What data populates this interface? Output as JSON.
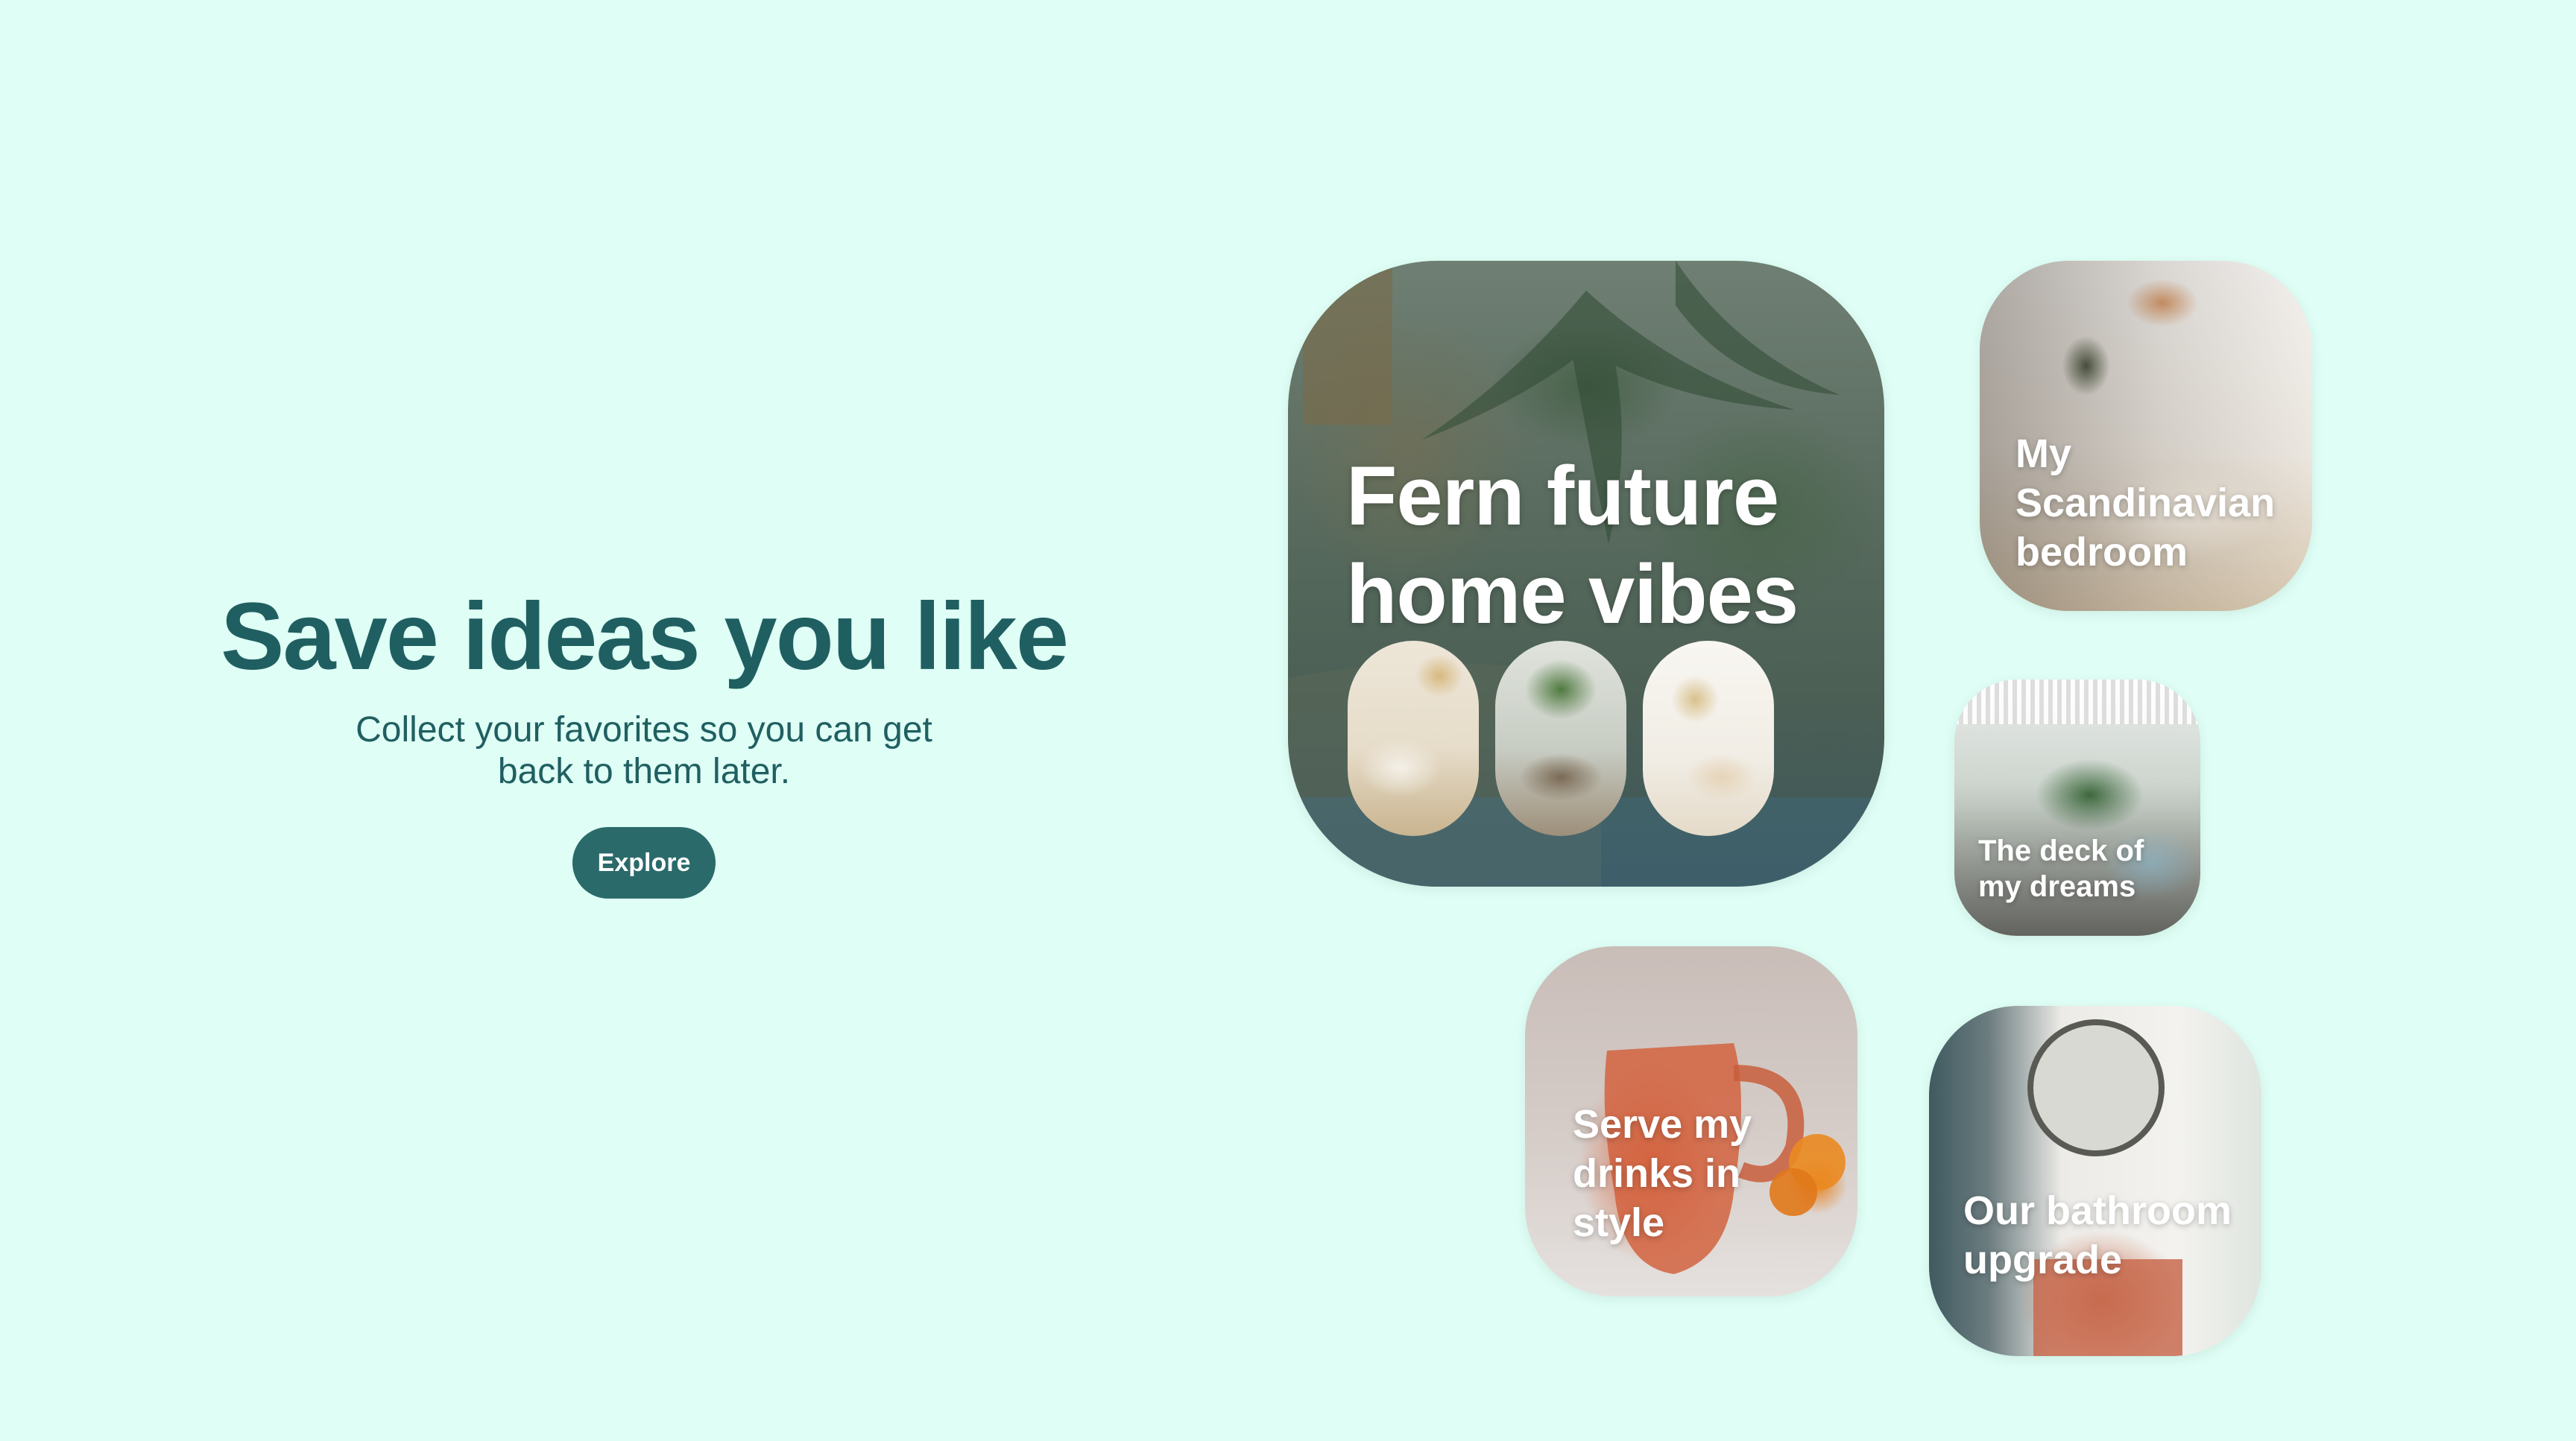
{
  "hero": {
    "title": "Save ideas you like",
    "subtitle": "Collect your favorites so you can get back to them later.",
    "button": "Explore"
  },
  "cards": {
    "fern": {
      "title": "Fern future home vibes"
    },
    "scandi": {
      "title": "My Scandinavian bedroom"
    },
    "deck": {
      "title": "The deck of my dreams"
    },
    "drinks": {
      "title": "Serve my drinks in style"
    },
    "bath": {
      "title": "Our bathroom upgrade"
    }
  },
  "colors": {
    "background": "#dffff6",
    "heading": "#205f61",
    "button": "#2b6a6a"
  }
}
